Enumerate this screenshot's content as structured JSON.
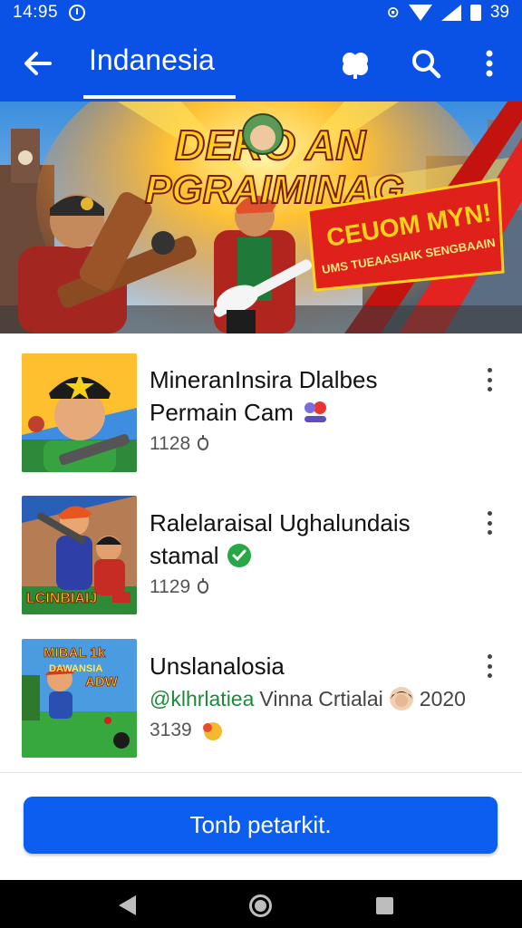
{
  "status_bar": {
    "time": "14:95",
    "battery": "39",
    "nfc_text": "➐"
  },
  "app_bar": {
    "title": "Indanesia",
    "back_icon": "arrow-left-icon",
    "actions": [
      "clover-icon",
      "search-icon",
      "more-vert-icon"
    ]
  },
  "hero": {
    "headline_line1": "DERO AN",
    "headline_line2": "PGRAIMINAG",
    "badge_title": "CEUOM MYN!",
    "badge_sub": "UMS TUEAASIAIK SENGBAAIN"
  },
  "items": [
    {
      "title_line1": "MineranInsira Dlalbes",
      "title_line2": "Permain Cam",
      "count": "1128",
      "badge_icon": "candy-emoji-icon"
    },
    {
      "title_line1": "Ralelaraisal Ughalundais",
      "title_line2": "stamal",
      "count": "1129",
      "badge_icon": "green-check-icon",
      "thumb_text": "LCINBIAIJ"
    },
    {
      "title_line1": "Unslanalosia",
      "subtitle_link": "@klhrlatiea",
      "subtitle_rest": "Vinna Crtialai",
      "year": "2020",
      "count": "3139",
      "thumb_text_1": "MIBAL 1k",
      "thumb_text_2": "DAWANSIA",
      "thumb_text_3": "ADW"
    }
  ],
  "cta": {
    "label": "Tonb petarkit."
  },
  "colors": {
    "primary": "#0a52e6",
    "button": "#0b5ef0"
  }
}
